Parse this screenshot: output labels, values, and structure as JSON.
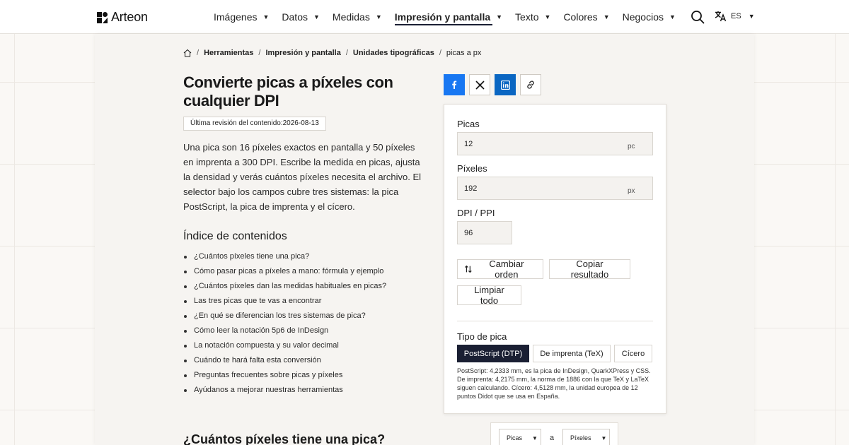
{
  "header": {
    "brand": "Arteon",
    "nav": [
      {
        "label": "Imágenes"
      },
      {
        "label": "Datos"
      },
      {
        "label": "Medidas"
      },
      {
        "label": "Impresión y pantalla",
        "active": true
      },
      {
        "label": "Texto"
      },
      {
        "label": "Colores"
      },
      {
        "label": "Negocios"
      }
    ],
    "language": "ES"
  },
  "breadcrumb": {
    "items": [
      "Herramientas",
      "Impresión y pantalla",
      "Unidades tipográficas"
    ],
    "current": "picas a px"
  },
  "page": {
    "title": "Convierte picas a píxeles con cualquier DPI",
    "revision": "Última revisión del contenido:2026-08-13",
    "intro": "Una pica son 16 píxeles exactos en pantalla y 50 píxeles en imprenta a 300 DPI. Escribe la medida en picas, ajusta la densidad y verás cuántos píxeles necesita el archivo. El selector bajo los campos cubre tres sistemas: la pica PostScript, la pica de imprenta y el cícero.",
    "toc_title": "Índice de contenidos",
    "toc": [
      "¿Cuántos píxeles tiene una pica?",
      "Cómo pasar picas a píxeles a mano: fórmula y ejemplo",
      "¿Cuántos píxeles dan las medidas habituales en picas?",
      "Las tres picas que te vas a encontrar",
      "¿En qué se diferencian los tres sistemas de pica?",
      "Cómo leer la notación 5p6 de InDesign",
      "La notación compuesta y su valor decimal",
      "Cuándo te hará falta esta conversión",
      "Preguntas frecuentes sobre picas y píxeles",
      "Ayúdanos a mejorar nuestras herramientas"
    ],
    "section_heading": "¿Cuántos píxeles tiene una pica?"
  },
  "converter": {
    "picas_label": "Picas",
    "picas_value": "12",
    "picas_unit": "pc",
    "pixels_label": "Píxeles",
    "pixels_value": "192",
    "pixels_unit": "px",
    "dpi_label": "DPI / PPI",
    "dpi_value": "96",
    "swap_label": "Cambiar orden",
    "copy_label": "Copiar resultado",
    "clear_label": "Limpiar todo",
    "type_label": "Tipo de pica",
    "types": [
      "PostScript (DTP)",
      "De imprenta (TeX)",
      "Cícero"
    ],
    "active_type": "PostScript (DTP)",
    "type_description": "PostScript: 4,2333 mm, es la pica de InDesign, QuarkXPress y CSS. De imprenta: 4,2175 mm, la norma de 1886 con la que TeX y LaTeX siguen calculando. Cícero: 4,5128 mm, la unidad europea de 12 puntos Didot que se usa en España."
  },
  "mini_converter": {
    "from": "Picas",
    "connector": "a",
    "to": "Píxeles"
  },
  "colors": {
    "accent_dark": "#1a1f33",
    "facebook": "#1877f2",
    "linkedin": "#0a66c2"
  }
}
